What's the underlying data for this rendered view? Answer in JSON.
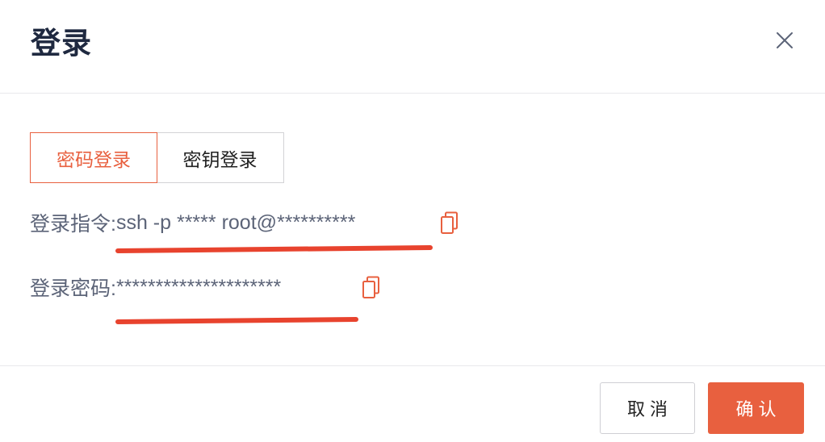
{
  "dialog": {
    "title": "登录",
    "close_icon": "close-icon"
  },
  "tabs": [
    {
      "label": "密码登录",
      "active": true
    },
    {
      "label": "密钥登录",
      "active": false
    }
  ],
  "login_command": {
    "label": "登录指令:",
    "value": "ssh -p ***** root@**********",
    "copy_icon": "copy-icon"
  },
  "login_password": {
    "label": "登录密码:",
    "value": "*********************",
    "copy_icon": "copy-icon"
  },
  "footer": {
    "cancel_label": "取 消",
    "confirm_label": "确 认"
  },
  "colors": {
    "accent": "#e8603f",
    "annotation": "#e8432e",
    "text": "#5c6478",
    "title": "#1f2940"
  }
}
